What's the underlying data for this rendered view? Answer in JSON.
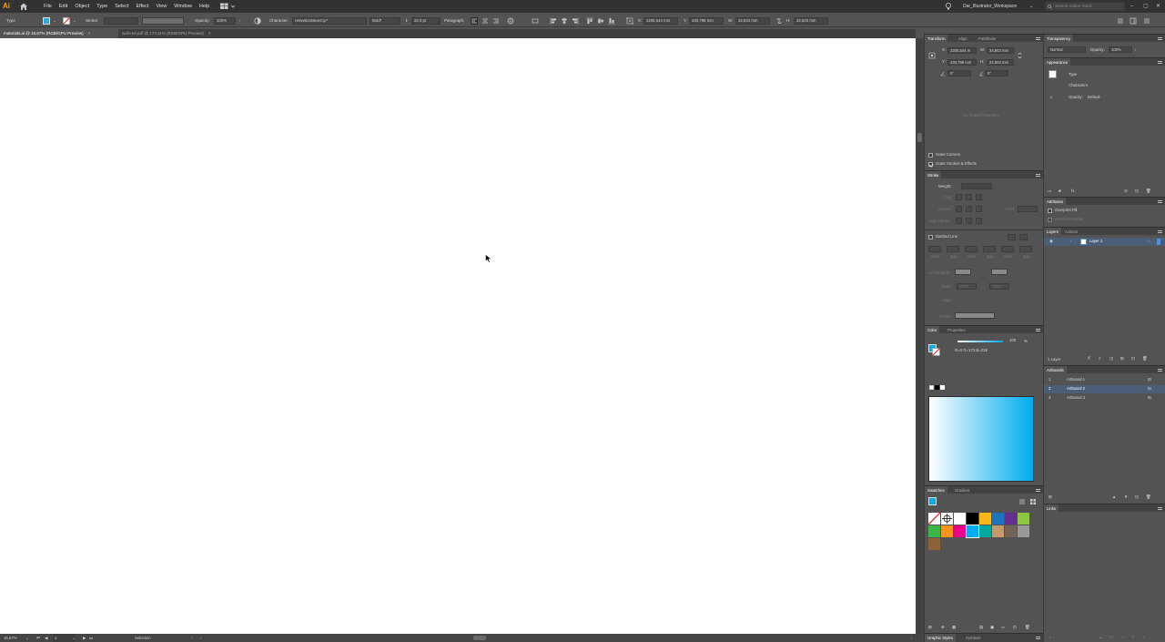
{
  "app": {
    "logo_text": "Ai",
    "menu": [
      "File",
      "Edit",
      "Object",
      "Type",
      "Select",
      "Effect",
      "View",
      "Window",
      "Help"
    ],
    "workspace": "Dar_Illustrator_Workspace",
    "search_placeholder": "Search Adobe Stock"
  },
  "control_bar": {
    "mode": "Type",
    "stroke_label": "Stroke:",
    "opacity_label": "Opacity:",
    "opacity_value": "100%",
    "character_label": "Character:",
    "font_family": "HelveticaNeueCyr*",
    "font_style": "Bold*",
    "font_size": "22,9 pt",
    "paragraph_label": "Paragraph:",
    "x_label": "X:",
    "x_value": "2205,544 mm",
    "y_label": "Y:",
    "y_value": "430,798 mm",
    "w_label": "W:",
    "w_value": "34,843 mm",
    "h_label": "H:",
    "h_value": "22,503 mm",
    "fill_color": "#29abe2"
  },
  "tabs": [
    {
      "label": "materials.ai @ 16,67% (RGB/GPU Preview)",
      "active": true,
      "close": "×"
    },
    {
      "label": "wall-red.pdf @ 174,11% (RGB/GPU Preview)",
      "active": false,
      "close": "×"
    }
  ],
  "status_bar": {
    "zoom": "16,67%",
    "artboard_num": "2",
    "tool": "Selection"
  },
  "transform": {
    "tabs": [
      "Transform",
      "Align",
      "Pathfinder"
    ],
    "x_label": "X:",
    "x_value": "2205,544 m",
    "y_label": "Y:",
    "y_value": "430,798 mm",
    "w_label": "W:",
    "w_value": "34,843 mm",
    "h_label": "H:",
    "h_value": "22,503 mm",
    "angle": "0°",
    "shear": "0°",
    "no_shape": "No Shape Properties",
    "scale_corners": "Scale Corners",
    "scale_strokes": "Scale Strokes & Effects"
  },
  "stroke": {
    "title": "Stroke",
    "weight_label": "Weight:",
    "cap_label": "Cap:",
    "corner_label": "Corner:",
    "limit_label": "Limit:",
    "align_label": "Align Stroke:",
    "dashed_label": "Dashed Line",
    "dash_labels": [
      "dash",
      "gap",
      "dash",
      "gap",
      "dash",
      "gap"
    ],
    "arrowheads_label": "Arrowheads:",
    "scale_label": "Scale:",
    "scale_1": "100%",
    "scale_2": "100%",
    "align2_label": "Align:",
    "profile_label": "Profile:"
  },
  "color": {
    "tabs": [
      "Color",
      "Properties"
    ],
    "value": "100",
    "pct": "%",
    "rgb": "R=0 G=173 B=238"
  },
  "swatches": {
    "tabs": [
      "Swatches",
      "Gradient"
    ],
    "row1": [
      "none",
      "registration",
      "#ffffff",
      "#000000",
      "#f7b718",
      "#1c75bc",
      "#662d91",
      "#8dc63f"
    ],
    "row2": [
      "#39b54a",
      "#f7931e",
      "#ec008c",
      "#00aeef",
      "#00a99d",
      "#c49a6c",
      "#736357",
      "#999999"
    ],
    "row3": [
      "#8c6239"
    ]
  },
  "bottom_tabs": [
    "Graphic Styles",
    "Symbols"
  ],
  "transparency": {
    "title": "Transparency",
    "blend": "Normal",
    "opacity_label": "Opacity:",
    "opacity": "100%"
  },
  "appearance": {
    "title": "Appearance",
    "type_label": "Type",
    "character_label": "Characters",
    "opacity_label": "Opacity:",
    "opacity_value": "Default"
  },
  "attributes": {
    "title": "Attributes",
    "overprint_fill": "Overprint Fill",
    "overprint_stroke": "Overprint Stroke"
  },
  "layers": {
    "tabs": [
      "Layers",
      "Actions"
    ],
    "items": [
      {
        "name": "Layer 1"
      }
    ],
    "count": "1 Layer"
  },
  "artboards": {
    "title": "Artboards",
    "items": [
      {
        "num": "1",
        "name": "Artboard 1"
      },
      {
        "num": "2",
        "name": "Artboard 2"
      },
      {
        "num": "3",
        "name": "Artboard 3"
      }
    ]
  },
  "links": {
    "title": "Links"
  }
}
